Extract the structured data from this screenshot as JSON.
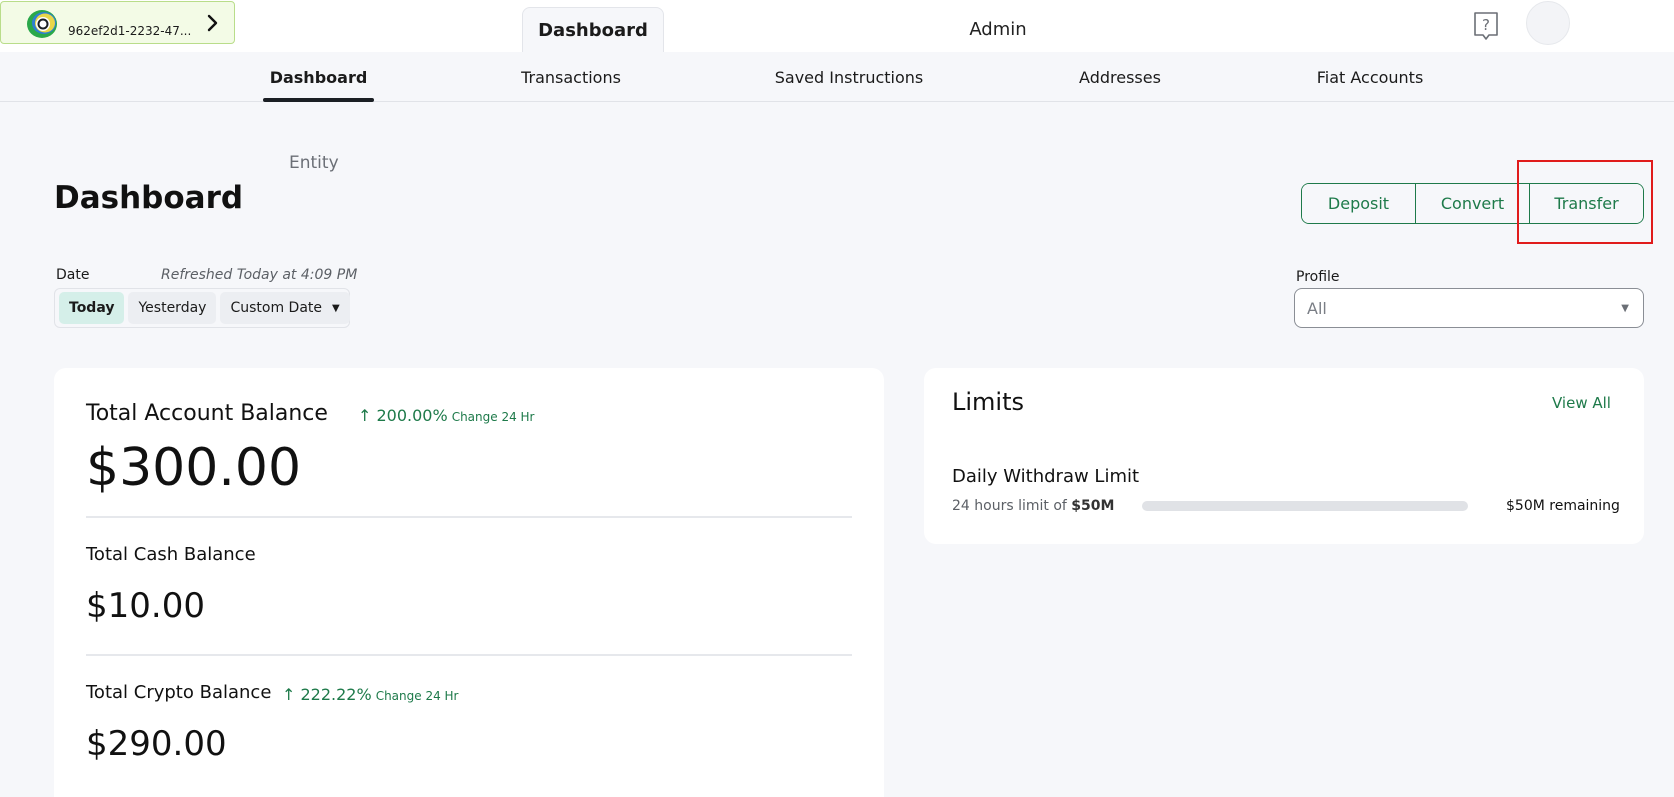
{
  "topbar": {
    "entity_id": "962ef2d1-2232-47...",
    "tabs": [
      {
        "label": "Dashboard",
        "active": true
      },
      {
        "label": "Admin",
        "active": false
      }
    ]
  },
  "subnav": {
    "items": [
      {
        "label": "Dashboard",
        "active": true
      },
      {
        "label": "Transactions",
        "active": false
      },
      {
        "label": "Saved Instructions",
        "active": false
      },
      {
        "label": "Addresses",
        "active": false
      },
      {
        "label": "Fiat Accounts",
        "active": false
      }
    ]
  },
  "header": {
    "entity_label": "Entity",
    "title": "Dashboard",
    "actions": [
      "Deposit",
      "Convert",
      "Transfer"
    ]
  },
  "date_filter": {
    "label": "Date",
    "refreshed": "Refreshed Today at 4:09 PM",
    "options": [
      "Today",
      "Yesterday",
      "Custom Date"
    ],
    "selected": "Today"
  },
  "profile": {
    "label": "Profile",
    "value": "All"
  },
  "balances": {
    "total_account": {
      "label": "Total Account Balance",
      "change": "200.00%",
      "change_note": "Change 24 Hr",
      "amount": "$300.00"
    },
    "total_cash": {
      "label": "Total Cash Balance",
      "amount": "$10.00"
    },
    "total_crypto": {
      "label": "Total Crypto Balance",
      "change": "222.22%",
      "change_note": "Change 24 Hr",
      "amount": "$290.00"
    }
  },
  "limits": {
    "title": "Limits",
    "view_all": "View All",
    "items": [
      {
        "name": "Daily Withdraw Limit",
        "desc_prefix": "24 hours limit of",
        "limit": "$50M",
        "remaining": "$50M remaining",
        "used_fraction": 0
      }
    ]
  },
  "colors": {
    "accent": "#1e7a4a",
    "highlight": "#e01b1b",
    "background": "#f6f7fa"
  }
}
